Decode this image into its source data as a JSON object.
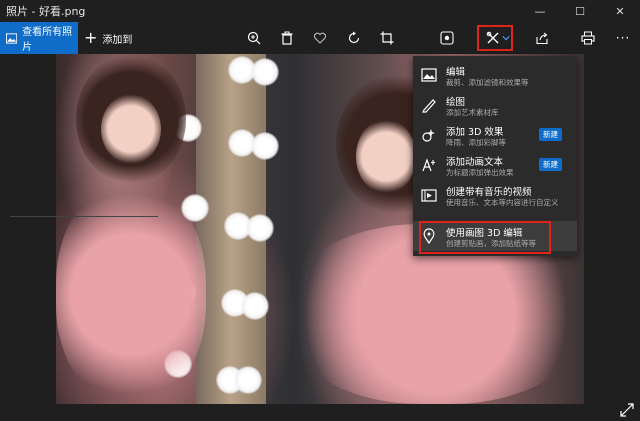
{
  "window": {
    "title": "照片 - 好看.png",
    "minimize": "—",
    "maximize": "☐",
    "close": "✕"
  },
  "toolbar": {
    "view_all_label": "查看所有照片",
    "add_to_label": "添加到",
    "icons": [
      "zoom-icon",
      "delete-icon",
      "heart-icon",
      "rotate-icon",
      "crop-icon",
      "enhance-icon",
      "edit-create-icon",
      "share-icon",
      "print-icon",
      "more-icon"
    ],
    "more_glyph": "···"
  },
  "menu": {
    "items": [
      {
        "title": "编辑",
        "subtitle": "裁剪、添加滤镜和效果等",
        "badge": ""
      },
      {
        "title": "绘图",
        "subtitle": "添加艺术素材库",
        "badge": ""
      },
      {
        "title": "添加 3D 效果",
        "subtitle": "降雨、添加彩脚等",
        "badge": "新建"
      },
      {
        "title": "添加动画文本",
        "subtitle": "为标题添加弹出效果",
        "badge": "新建"
      },
      {
        "title": "创建带有音乐的视频",
        "subtitle": "使用音乐、文本等内容进行自定义",
        "badge": ""
      },
      {
        "title": "使用画图 3D 编辑",
        "subtitle": "创建剪贴画，添加贴纸等等",
        "badge": ""
      }
    ]
  },
  "colors": {
    "accent": "#0f6cc9",
    "highlight_border": "#e0241b",
    "menu_bg": "#2b2b2b",
    "toolbar_bg": "#1f1f1f"
  }
}
